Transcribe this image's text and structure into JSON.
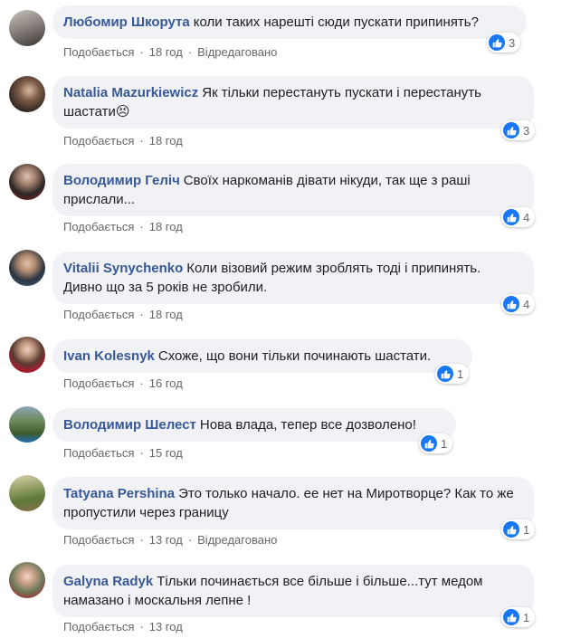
{
  "comments": [
    {
      "author": "Любомир Шкорута",
      "text": "коли таких нарешті сюди пускати припинять?",
      "like_label": "Подобається",
      "time": "18 год",
      "edited": "Відредаговано",
      "reactions": "3"
    },
    {
      "author": "Natalia Mazurkiewicz",
      "text": "Як тільки перестануть пускати і перестануть шастати😣",
      "like_label": "Подобається",
      "time": "18 год",
      "edited": "",
      "reactions": "3"
    },
    {
      "author": "Володимир Геліч",
      "text": "Своїх наркоманів дівати нікуди, так ще з раші прислали...",
      "like_label": "Подобається",
      "time": "18 год",
      "edited": "",
      "reactions": "4"
    },
    {
      "author": "Vitalii Synychenko",
      "text": "Коли візовий режим зроблять тоді і припинять. Дивно що за 5 років не зробили.",
      "like_label": "Подобається",
      "time": "18 год",
      "edited": "",
      "reactions": "4"
    },
    {
      "author": "Ivan Kolesnyk",
      "text": "Схоже, що вони тільки починають шастати.",
      "like_label": "Подобається",
      "time": "16 год",
      "edited": "",
      "reactions": "1"
    },
    {
      "author": "Володимир Шелест",
      "text": "Нова влада, тепер все дозволено!",
      "like_label": "Подобається",
      "time": "15 год",
      "edited": "",
      "reactions": "1"
    },
    {
      "author": "Tatyana Pershina",
      "text": "Это только начало. ее нет на Миротворце? Как то же пропустили через границу",
      "like_label": "Подобається",
      "time": "13 год",
      "edited": "Відредаговано",
      "reactions": "1"
    },
    {
      "author": "Galyna Radyk",
      "text": "Тільки починається все більше і більше...тут медом намазано і москальня лепне !",
      "like_label": "Подобається",
      "time": "13 год",
      "edited": "",
      "reactions": "1"
    }
  ]
}
